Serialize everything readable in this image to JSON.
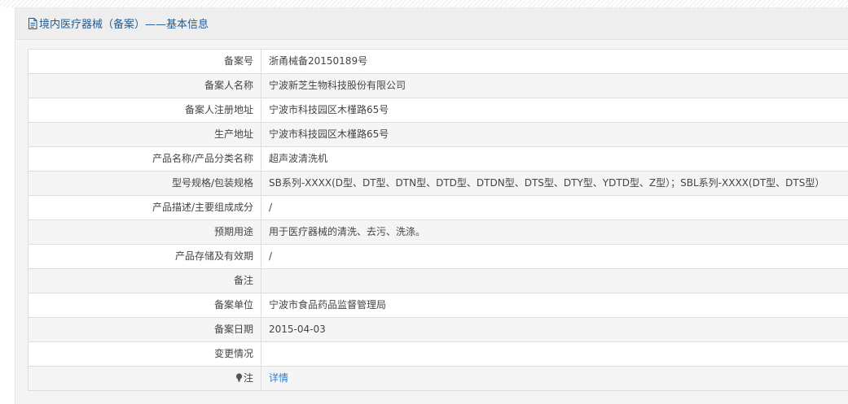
{
  "panel": {
    "title": "境内医疗器械（备案）——基本信息"
  },
  "rows": [
    {
      "label": "备案号",
      "value": "浙甬械备20150189号"
    },
    {
      "label": "备案人名称",
      "value": "宁波新芝生物科技股份有限公司"
    },
    {
      "label": "备案人注册地址",
      "value": "宁波市科技园区木槿路65号"
    },
    {
      "label": "生产地址",
      "value": "宁波市科技园区木槿路65号"
    },
    {
      "label": "产品名称/产品分类名称",
      "value": "超声波清洗机"
    },
    {
      "label": "型号规格/包装规格",
      "value": "SB系列-XXXX(D型、DT型、DTN型、DTD型、DTDN型、DTS型、DTY型、YDTD型、Z型）；SBL系列-XXXX(DT型、DTS型）"
    },
    {
      "label": "产品描述/主要组成成分",
      "value": "/"
    },
    {
      "label": "预期用途",
      "value": "用于医疗器械的清洗、去污、洗涤。"
    },
    {
      "label": "产品存储及有效期",
      "value": "/"
    },
    {
      "label": "备注",
      "value": ""
    },
    {
      "label": "备案单位",
      "value": "宁波市食品药品监督管理局"
    },
    {
      "label": "备案日期",
      "value": "2015-04-03"
    },
    {
      "label": "变更情况",
      "value": ""
    }
  ],
  "note_row": {
    "label": "注",
    "link_text": "详情",
    "icon": "lightbulb-icon"
  },
  "colors": {
    "title": "#1f5c93",
    "link": "#2a7fcc",
    "border": "#dddddd"
  }
}
